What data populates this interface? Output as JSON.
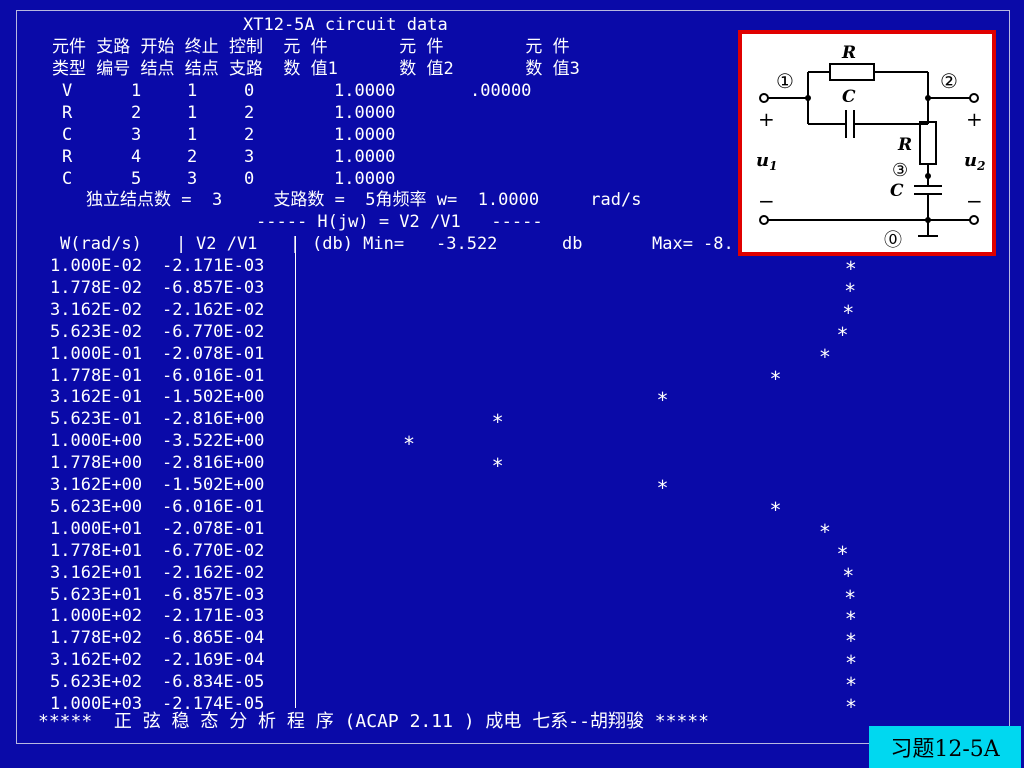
{
  "header": {
    "title": "XT12-5A circuit data",
    "col_row1": "元件 支路 开始 终止 控制  元 件       元 件        元 件",
    "col_row2": "类型 编号 结点 结点 支路  数 值1      数 值2       数 值3"
  },
  "elements": [
    {
      "type": "V",
      "branch": "1",
      "from": "1",
      "to": "0",
      "value1": "1.0000",
      "value2": ".00000"
    },
    {
      "type": "R",
      "branch": "2",
      "from": "1",
      "to": "2",
      "value1": "1.0000",
      "value2": ""
    },
    {
      "type": "C",
      "branch": "3",
      "from": "1",
      "to": "2",
      "value1": "1.0000",
      "value2": ""
    },
    {
      "type": "R",
      "branch": "4",
      "from": "2",
      "to": "3",
      "value1": "1.0000",
      "value2": ""
    },
    {
      "type": "C",
      "branch": "5",
      "from": "3",
      "to": "0",
      "value1": "1.0000",
      "value2": ""
    }
  ],
  "summary": "独立结点数 =  3     支路数 =  5角频率 w=  1.0000     rad/s",
  "function_line": "----- H(jw) = V2 /V1   -----",
  "table_header": {
    "w_label": "W(rad/s)",
    "sep1": "|",
    "ratio_label": "V2 /V1",
    "sep2": "|",
    "db_label": "(db) Min=",
    "min_value": "-3.522",
    "db_unit": "db",
    "max_label": "Max=",
    "max_value": "-8."
  },
  "rows": [
    {
      "w": "1.000E-02",
      "v": "-2.171E-03"
    },
    {
      "w": "1.778E-02",
      "v": "-6.857E-03"
    },
    {
      "w": "3.162E-02",
      "v": "-2.162E-02"
    },
    {
      "w": "5.623E-02",
      "v": "-6.770E-02"
    },
    {
      "w": "1.000E-01",
      "v": "-2.078E-01"
    },
    {
      "w": "1.778E-01",
      "v": "-6.016E-01"
    },
    {
      "w": "3.162E-01",
      "v": "-1.502E+00"
    },
    {
      "w": "5.623E-01",
      "v": "-2.816E+00"
    },
    {
      "w": "1.000E+00",
      "v": "-3.522E+00"
    },
    {
      "w": "1.778E+00",
      "v": "-2.816E+00"
    },
    {
      "w": "3.162E+00",
      "v": "-1.502E+00"
    },
    {
      "w": "5.623E+00",
      "v": "-6.016E-01"
    },
    {
      "w": "1.000E+01",
      "v": "-2.078E-01"
    },
    {
      "w": "1.778E+01",
      "v": "-6.770E-02"
    },
    {
      "w": "3.162E+01",
      "v": "-2.162E-02"
    },
    {
      "w": "5.623E+01",
      "v": "-6.857E-03"
    },
    {
      "w": "1.000E+02",
      "v": "-2.171E-03"
    },
    {
      "w": "1.778E+02",
      "v": "-6.865E-04"
    },
    {
      "w": "3.162E+02",
      "v": "-2.169E-04"
    },
    {
      "w": "5.623E+02",
      "v": "-6.834E-05"
    },
    {
      "w": "1.000E+03",
      "v": "-2.174E-05"
    }
  ],
  "plot_marker": "*",
  "footer": "*****  正 弦 稳 态 分 析 程 序 (ACAP 2.11 ) 成电 七系--胡翔骏 *****",
  "circuit": {
    "R_top": "R",
    "C_top": "C",
    "R_shunt": "R",
    "C_shunt": "C",
    "node1": "①",
    "node2": "②",
    "node3": "③",
    "node0": "⓪",
    "u1": "u",
    "u1_sub": "1",
    "u2": "u",
    "u2_sub": "2",
    "plus": "+",
    "minus": "−"
  },
  "badge": "习题12-5A",
  "colors": {
    "background": "#0a0aa8",
    "text": "#ffffff",
    "frame_border": "#e00000",
    "badge_bg": "#00d8f0"
  }
}
